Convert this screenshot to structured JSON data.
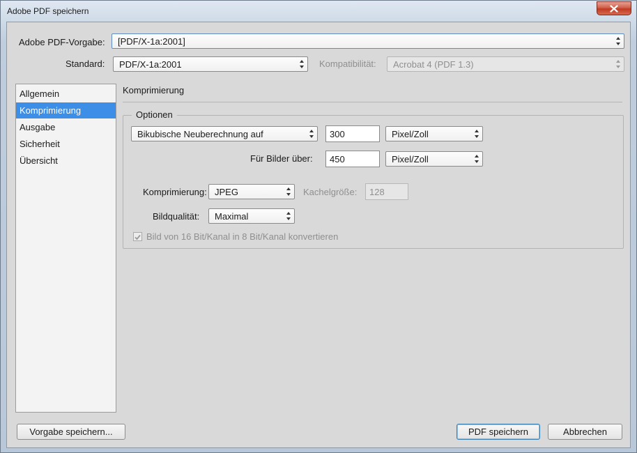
{
  "window": {
    "title": "Adobe PDF speichern"
  },
  "preset": {
    "label": "Adobe PDF-Vorgabe:",
    "value": "[PDF/X-1a:2001]"
  },
  "standard": {
    "label": "Standard:",
    "value": "PDF/X-1a:2001"
  },
  "compatibility": {
    "label": "Kompatibilität:",
    "value": "Acrobat 4 (PDF 1.3)"
  },
  "sidebar": {
    "items": [
      {
        "label": "Allgemein"
      },
      {
        "label": "Komprimierung",
        "selected": true
      },
      {
        "label": "Ausgabe"
      },
      {
        "label": "Sicherheit"
      },
      {
        "label": "Übersicht"
      }
    ]
  },
  "section": {
    "title": "Komprimierung"
  },
  "options": {
    "legend": "Optionen",
    "resample_method": "Bikubische Neuberechnung auf",
    "resample_value": "300",
    "resample_unit": "Pixel/Zoll",
    "above_label": "Für Bilder über:",
    "above_value": "450",
    "above_unit": "Pixel/Zoll",
    "compression_label": "Komprimierung:",
    "compression_value": "JPEG",
    "tile_size_label": "Kachelgröße:",
    "tile_size_value": "128",
    "quality_label": "Bildqualität:",
    "quality_value": "Maximal",
    "convert_16bit_label": "Bild von 16 Bit/Kanal in 8 Bit/Kanal konvertieren",
    "convert_16bit_checked": true
  },
  "buttons": {
    "save_preset": "Vorgabe speichern...",
    "save_pdf": "PDF speichern",
    "cancel": "Abbrechen"
  },
  "icons": {
    "close": "close-icon",
    "select_arrows": "updown-arrows-icon",
    "check": "checkmark-icon"
  }
}
